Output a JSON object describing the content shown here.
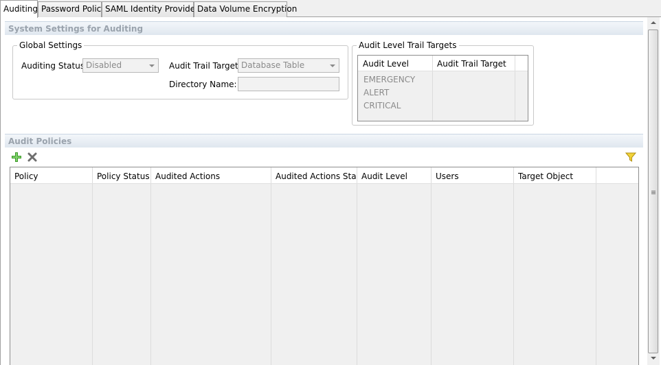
{
  "tabs": [
    {
      "label": "Auditing",
      "active": true
    },
    {
      "label": "Password Policy",
      "active": false
    },
    {
      "label": "SAML Identity Providers",
      "active": false
    },
    {
      "label": "Data Volume Encryption",
      "active": false
    }
  ],
  "system_settings": {
    "title": "System Settings for Auditing",
    "global_settings": {
      "legend": "Global Settings",
      "auditing_status_label": "Auditing Status:",
      "auditing_status_value": "Disabled",
      "audit_trail_target_label": "Audit Trail Target:",
      "audit_trail_target_value": "Database Table",
      "directory_name_label": "Directory Name:",
      "directory_name_value": ""
    },
    "trail_targets": {
      "legend": "Audit Level Trail Targets",
      "columns": [
        "Audit Level",
        "Audit Trail Target"
      ],
      "rows": [
        "EMERGENCY",
        "ALERT",
        "CRITICAL"
      ]
    }
  },
  "audit_policies": {
    "title": "Audit Policies",
    "toolbar": {
      "add_icon": "plus-icon",
      "delete_icon": "delete-icon",
      "filter_icon": "filter-icon"
    },
    "columns": [
      "Policy",
      "Policy Status",
      "Audited Actions",
      "Audited Actions Sta...",
      "Audit Level",
      "Users",
      "Target Object"
    ]
  },
  "colors": {
    "header_gradient": "#dfe7ef",
    "disabled_text": "#8a8a8a",
    "add_icon": "#3c9a2a",
    "filter_icon": "#e8c31a"
  }
}
